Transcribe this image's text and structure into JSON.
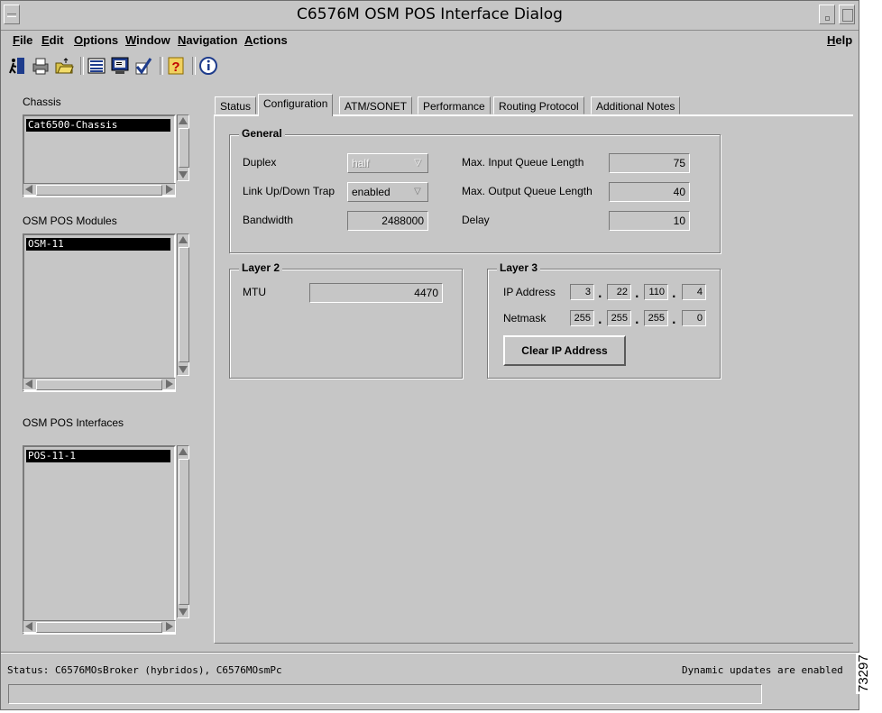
{
  "window": {
    "title": "C6576M OSM POS Interface Dialog"
  },
  "menu": [
    "File",
    "Edit",
    "Options",
    "Window",
    "Navigation",
    "Actions"
  ],
  "help": "Help",
  "toolbar": [
    "exit-icon",
    "print-icon",
    "open-folder-icon",
    "list-icon",
    "monitor-icon",
    "check-icon",
    "help-icon",
    "info-icon"
  ],
  "chassis": {
    "label": "Chassis",
    "selected": "Cat6500-Chassis"
  },
  "modules": {
    "label": "OSM POS Modules",
    "selected": "OSM-11"
  },
  "interfaces": {
    "label": "OSM POS Interfaces",
    "selected": "POS-11-1"
  },
  "tabs": [
    "Status",
    "Configuration",
    "ATM/SONET",
    "Performance",
    "Routing Protocol",
    "Additional Notes"
  ],
  "active_tab": "Configuration",
  "general": {
    "title": "General",
    "duplex_label": "Duplex",
    "duplex_value": "half",
    "trap_label": "Link Up/Down Trap",
    "trap_value": "enabled",
    "bandwidth_label": "Bandwidth",
    "bandwidth_value": "2488000",
    "max_in_label": "Max. Input Queue Length",
    "max_in_value": "75",
    "max_out_label": "Max. Output Queue Length",
    "max_out_value": "40",
    "delay_label": "Delay",
    "delay_value": "10"
  },
  "layer2": {
    "title": "Layer 2",
    "mtu_label": "MTU",
    "mtu_value": "4470"
  },
  "layer3": {
    "title": "Layer 3",
    "ip_label": "IP Address",
    "ip": [
      "3",
      "22",
      "110",
      "4"
    ],
    "mask_label": "Netmask",
    "mask": [
      "255",
      "255",
      "255",
      "0"
    ],
    "clear_button": "Clear IP Address"
  },
  "status": {
    "left": "Status: C6576MOsBroker (hybridos), C6576MOsmPc",
    "right": "Dynamic updates are enabled"
  },
  "figure_id": "73297"
}
